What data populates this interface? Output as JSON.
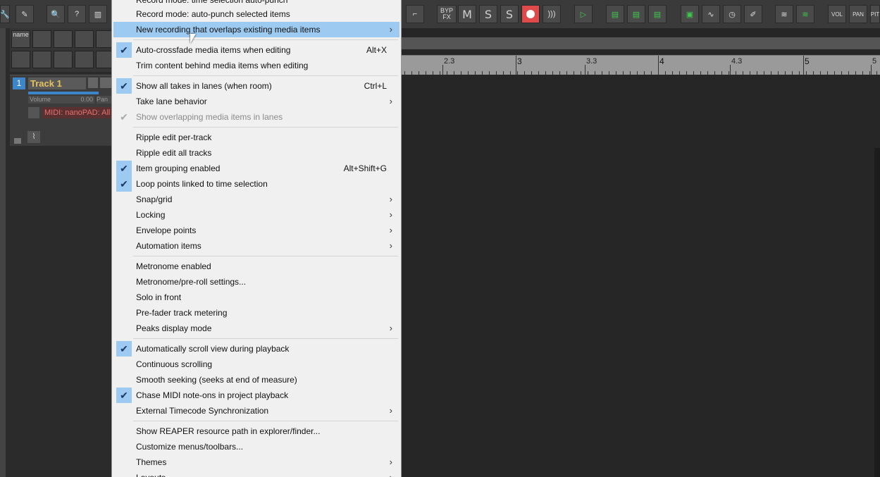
{
  "toolbar": {
    "byp_label": "BYP",
    "fx_label": "FX",
    "m_label": "M",
    "s_label": "S",
    "xs_label": "S",
    "vol_label": "VOL",
    "pan_label": "PAN",
    "pit_label": "PIT"
  },
  "track_panel": {
    "name_label": "name",
    "track_number": "1",
    "track_name": "Track 1",
    "volume_label": "Volume",
    "volume_value": "0.00",
    "pan_label": "Pan",
    "midi_input": "MIDI: nanoPAD: All c"
  },
  "ruler": {
    "labels": [
      {
        "text": "2.3",
        "major": false
      },
      {
        "text": "3",
        "major": true
      },
      {
        "text": "3.3",
        "major": false
      },
      {
        "text": "4",
        "major": true
      },
      {
        "text": "4.3",
        "major": false
      },
      {
        "text": "5",
        "major": true
      },
      {
        "text": "5",
        "major": false
      }
    ]
  },
  "menu": {
    "items": [
      {
        "label": "Record mode: time selection auto-punch",
        "checked": false
      },
      {
        "label": "Record mode: auto-punch selected items",
        "checked": false
      },
      {
        "label": "New recording that overlaps existing media items",
        "submenu": true,
        "highlighted": true
      },
      {
        "label": "Auto-crossfade media items when editing",
        "checked": true,
        "shortcut": "Alt+X"
      },
      {
        "label": "Trim content behind media items when editing",
        "checked": false
      },
      {
        "label": "Show all takes in lanes (when room)",
        "checked": true,
        "shortcut": "Ctrl+L"
      },
      {
        "label": "Take lane behavior",
        "submenu": true
      },
      {
        "label": "Show overlapping media items in lanes",
        "checked": true,
        "disabled": true
      },
      {
        "label": "Ripple edit per-track"
      },
      {
        "label": "Ripple edit all tracks"
      },
      {
        "label": "Item grouping enabled",
        "checked": true,
        "shortcut": "Alt+Shift+G"
      },
      {
        "label": "Loop points linked to time selection",
        "checked": true
      },
      {
        "label": "Snap/grid",
        "submenu": true
      },
      {
        "label": "Locking",
        "submenu": true
      },
      {
        "label": "Envelope points",
        "submenu": true
      },
      {
        "label": "Automation items",
        "submenu": true
      },
      {
        "label": "Metronome enabled"
      },
      {
        "label": "Metronome/pre-roll settings..."
      },
      {
        "label": "Solo in front"
      },
      {
        "label": "Pre-fader track metering"
      },
      {
        "label": "Peaks display mode",
        "submenu": true
      },
      {
        "label": "Automatically scroll view during playback",
        "checked": true
      },
      {
        "label": "Continuous scrolling"
      },
      {
        "label": "Smooth seeking (seeks at end of measure)"
      },
      {
        "label": "Chase MIDI note-ons in project playback",
        "checked": true
      },
      {
        "label": "External Timecode Synchronization",
        "submenu": true
      },
      {
        "label": "Show REAPER resource path in explorer/finder..."
      },
      {
        "label": "Customize menus/toolbars..."
      },
      {
        "label": "Themes",
        "submenu": true
      },
      {
        "label": "Layouts",
        "submenu": true
      }
    ],
    "submenu_arrow": "›",
    "check_glyph": "✔"
  },
  "colors": {
    "menu_bg": "#f0f0f0",
    "highlight": "#9ccaf0",
    "record": "#e04a4a",
    "track_accent": "#3d86c9"
  }
}
